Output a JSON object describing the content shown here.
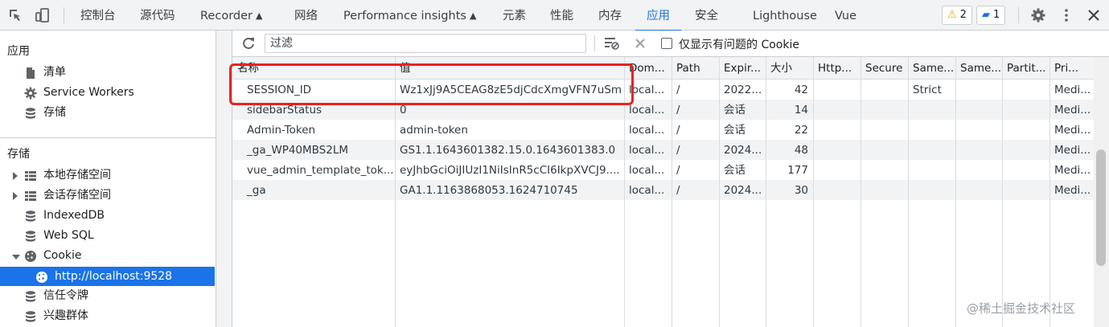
{
  "topbar": {
    "tabs": [
      {
        "label": "控制台"
      },
      {
        "label": "源代码"
      },
      {
        "label": "Recorder"
      },
      {
        "label": "网络"
      },
      {
        "label": "Performance insights"
      },
      {
        "label": "元素"
      },
      {
        "label": "性能"
      },
      {
        "label": "内存"
      },
      {
        "label": "应用"
      },
      {
        "label": "安全"
      },
      {
        "label": "Lighthouse"
      },
      {
        "label": "Vue"
      }
    ],
    "active_tab": "应用",
    "warnings_count": "2",
    "messages_count": "1"
  },
  "sidebar": {
    "app_header": "应用",
    "app_items": [
      {
        "label": "清单",
        "icon": "file-icon"
      },
      {
        "label": "Service Workers",
        "icon": "gear-icon"
      },
      {
        "label": "存储",
        "icon": "database-icon"
      }
    ],
    "storage_header": "存储",
    "storage_items": [
      {
        "label": "本地存储空间",
        "icon": "grid-icon"
      },
      {
        "label": "会话存储空间",
        "icon": "grid-icon"
      },
      {
        "label": "IndexedDB",
        "icon": "database-icon"
      },
      {
        "label": "Web SQL",
        "icon": "database-icon"
      },
      {
        "label": "Cookie",
        "icon": "cookie-icon"
      },
      {
        "label": "http://localhost:9528",
        "icon": "cookie-icon"
      },
      {
        "label": "信任令牌",
        "icon": "database-icon"
      },
      {
        "label": "兴趣群体",
        "icon": "database-icon"
      }
    ]
  },
  "toolbar": {
    "filter_placeholder": "过滤",
    "only_issues_label": "仅显示有问题的 Cookie"
  },
  "table": {
    "headers": [
      "名称",
      "值",
      "Dom...",
      "Path",
      "Expir...",
      "大小",
      "Http...",
      "Secure",
      "Same...",
      "Same...",
      "Partit...",
      "Pri..."
    ],
    "rows": [
      [
        "SESSION_ID",
        "Wz1xJj9A5CEAG8zE5djCdcXmgVFN7uSm",
        "local...",
        "/",
        "2022...",
        "42",
        "",
        "",
        "Strict",
        "",
        "",
        "Medi..."
      ],
      [
        "sidebarStatus",
        "0",
        "local...",
        "/",
        "会话",
        "14",
        "",
        "",
        "",
        "",
        "",
        "Medi..."
      ],
      [
        "Admin-Token",
        "admin-token",
        "local...",
        "/",
        "会话",
        "22",
        "",
        "",
        "",
        "",
        "",
        "Medi..."
      ],
      [
        "_ga_WP40MBS2LM",
        "GS1.1.1643601382.15.0.1643601383.0",
        "local...",
        "/",
        "2024...",
        "48",
        "",
        "",
        "",
        "",
        "",
        "Medi..."
      ],
      [
        "vue_admin_template_tok...",
        "eyJhbGciOiJIUzI1NiIsInR5cCI6IkpXVCJ9....",
        "local...",
        "/",
        "会话",
        "177",
        "",
        "",
        "",
        "",
        "",
        "Medi..."
      ],
      [
        "_ga",
        "GA1.1.1163868053.1624710745",
        "local...",
        "/",
        "2024...",
        "30",
        "",
        "",
        "",
        "",
        "",
        "Medi..."
      ]
    ]
  },
  "watermark": "@稀土掘金技术社区",
  "colors": {
    "accent": "#1a73e8",
    "highlight_box": "#e8231f"
  }
}
